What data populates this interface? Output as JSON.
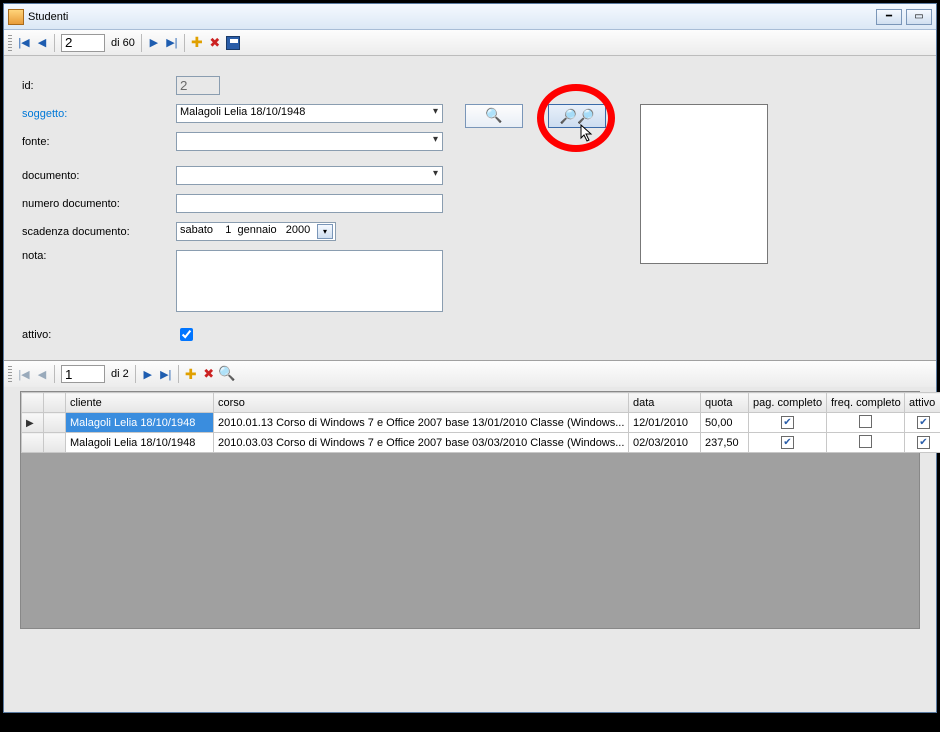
{
  "window": {
    "title": "Studenti"
  },
  "nav_top": {
    "position": "2",
    "of_label": "di 60"
  },
  "form": {
    "id_label": "id:",
    "id_value": "2",
    "soggetto_label": "soggetto:",
    "soggetto_value": "Malagoli Lelia 18/10/1948",
    "fonte_label": "fonte:",
    "fonte_value": "",
    "documento_label": "documento:",
    "documento_value": "",
    "numero_documento_label": "numero documento:",
    "numero_documento_value": "",
    "scadenza_label": "scadenza documento:",
    "scadenza_value": "sabato    1  gennaio   2000",
    "nota_label": "nota:",
    "nota_value": "",
    "attivo_label": "attivo:",
    "attivo_checked": true
  },
  "nav_sub": {
    "position": "1",
    "of_label": "di 2"
  },
  "grid": {
    "headers": {
      "cliente": "cliente",
      "corso": "corso",
      "data": "data",
      "quota": "quota",
      "pag": "pag. completo",
      "freq": "freq. completo",
      "attivo": "attivo"
    },
    "rows": [
      {
        "cliente": "Malagoli Lelia 18/10/1948",
        "corso": "2010.01.13 Corso di Windows 7 e Office 2007 base 13/01/2010 Classe (Windows...",
        "data": "12/01/2010",
        "quota": "50,00",
        "pag": true,
        "freq": false,
        "attivo": true,
        "selected": true
      },
      {
        "cliente": "Malagoli Lelia 18/10/1948",
        "corso": "2010.03.03 Corso di Windows 7 e Office 2007 base 03/03/2010 Classe (Windows...",
        "data": "02/03/2010",
        "quota": "237,50",
        "pag": true,
        "freq": false,
        "attivo": true,
        "selected": false
      }
    ]
  }
}
